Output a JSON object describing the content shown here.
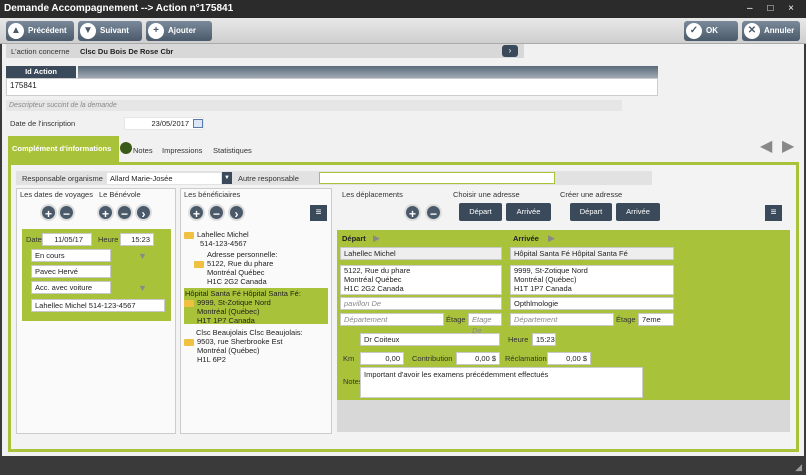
{
  "window": {
    "title": "Demande Accompagnement --> Action n°175841",
    "controls": "– □ ×"
  },
  "toolbar": {
    "prev": "Précédent",
    "next": "Suivant",
    "add": "Ajouter",
    "ok": "OK",
    "cancel": "Annuler"
  },
  "action": {
    "concerne_label": "L'action concerne",
    "concerne_value": "Clsc Du Bois De Rose Cbr",
    "id_label": "Id Action",
    "id_value": "175841",
    "desc_placeholder": "Descripteur succint de la demande",
    "date_label": "Date de l'inscription",
    "date_value": "23/05/2017"
  },
  "tabs": [
    {
      "label": "Complément d'informations"
    },
    {
      "label": "Notes"
    },
    {
      "label": "Impressions"
    },
    {
      "label": "Statistiques"
    }
  ],
  "resp": {
    "label": "Responsable organisme",
    "value": "Allard Marie-Josée",
    "other_label": "Autre responsable"
  },
  "voyages": {
    "label": "Les dates de voyages",
    "benevole_label": "Le Bénévole",
    "date_label": "Date",
    "date_value": "11/05/17",
    "heure_label": "Heure",
    "heure_value": "15:23",
    "status": "En cours",
    "benevole_value": "Pavec Hervé",
    "acc": "Acc. avec voiture",
    "contact": "Lahellec Michel   514-123-4567"
  },
  "beneficiaires": {
    "label": "Les bénéficiaires",
    "items": [
      {
        "line1": "Lahellec Michel",
        "line2": "514-123-4567"
      },
      {
        "line1": "Adresse personnelle:",
        "line2": "5122, Rue du phare",
        "line3": "Montréal Québec",
        "line4": "H1C 2G2 Canada"
      },
      {
        "line1": "Hôpital Santa Fé Hôpital Santa Fé:",
        "line2": "9999, St-Zotique Nord",
        "line3": "Montréal (Québec)",
        "line4": "H1T 1P7 Canada"
      },
      {
        "line1": "Clsc Beaujolais Clsc Beaujolais:",
        "line2": "9503, rue Sherbrooke Est",
        "line3": "Montréal (Québec)",
        "line4": "H1L 6P2"
      }
    ]
  },
  "deplacements": {
    "label": "Les déplacements",
    "choose_label": "Choisir une adresse",
    "create_label": "Créer une adresse",
    "depart_btn": "Départ",
    "arrivee_btn": "Arrivée"
  },
  "depart": {
    "label": "Départ",
    "name": "Lahellec Michel",
    "addr1": "5122, Rue du phare",
    "addr2": "Montréal Québec",
    "addr3": "H1C 2G2 Canada",
    "pavillon_placeholder": "pavillon De",
    "dept_placeholder": "Département",
    "etage_label": "Étage",
    "etage_placeholder": "Etage De"
  },
  "arrivee": {
    "label": "Arrivée",
    "name": "Hôpital Santa Fé Hôpital Santa Fé",
    "addr1": "9999, St-Zotique Nord",
    "addr2": "Montréal (Québec)",
    "addr3": "H1T 1P7 Canada",
    "service": "Opthlmologie",
    "dept_placeholder": "Département",
    "etage_label": "Étage",
    "etage_value": "7eme"
  },
  "trip": {
    "driver": "Dr Coiteux",
    "heure_label": "Heure",
    "heure_value": "15:23",
    "km_label": "Km",
    "km_value": "0,00",
    "contrib_label": "Contribution",
    "contrib_value": "0,00 $",
    "reclam_label": "Réclamation",
    "reclam_value": "0,00 $",
    "notes_label": "Notes",
    "notes_value": "Important d'avoir les examens précédemment effectués"
  },
  "colors": {
    "accent": "#a8c33a",
    "dark_button": "#3a4a5a",
    "titlebar": "#2b2b2b"
  }
}
